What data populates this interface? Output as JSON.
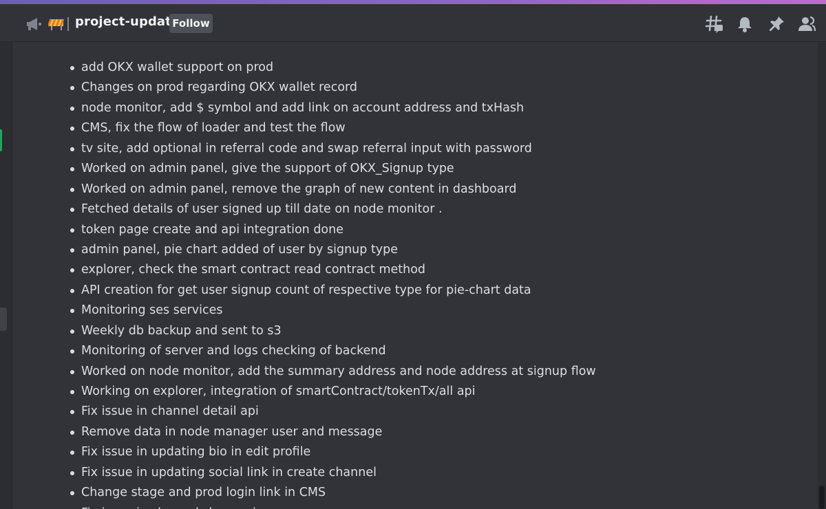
{
  "header": {
    "channel_name": "project-updates",
    "follow_label": "Follow",
    "channel_type_icon": "megaphone-icon",
    "channel_emoji": "construction-barrier-icon",
    "toolbar_icons": [
      "threads-icon",
      "bell-icon",
      "pin-icon",
      "members-icon"
    ]
  },
  "colors": {
    "background": "#313338",
    "text": "#dbdee1",
    "header_text": "#f2f3f5",
    "button_bg": "#4e5058",
    "accent_strip": "#8b66c6"
  },
  "message": {
    "items": [
      "add OKX wallet support on prod",
      "Changes on prod regarding OKX wallet record",
      "node monitor, add $ symbol and add link on account address and txHash",
      "CMS, fix the flow of loader and test the flow",
      "tv site, add optional in referral code and swap referral input with password",
      "Worked on admin panel, give the support of OKX_Signup type",
      "Worked on admin panel, remove the graph of new content in dashboard",
      "Fetched details of user signed up till date on node monitor .",
      "token page create and api integration done",
      "admin panel, pie chart added of user by signup type",
      "explorer, check the smart contract read contract method",
      "API creation for get user signup count of respective type for pie-chart data",
      "Monitoring ses services",
      "Weekly db backup and sent to s3",
      "Monitoring of server and logs checking of backend",
      "Worked on node monitor, add the summary address and node address at signup flow",
      "Working on explorer, integration of smartContract/tokenTx/all api",
      "Fix issue in channel detail api",
      "Remove data in node manager user and message",
      "Fix issue in updating bio in edit profile",
      "Fix issue in updating social link in create channel",
      "Change stage and prod login link in CMS",
      "Fix issue in channel show api"
    ]
  }
}
